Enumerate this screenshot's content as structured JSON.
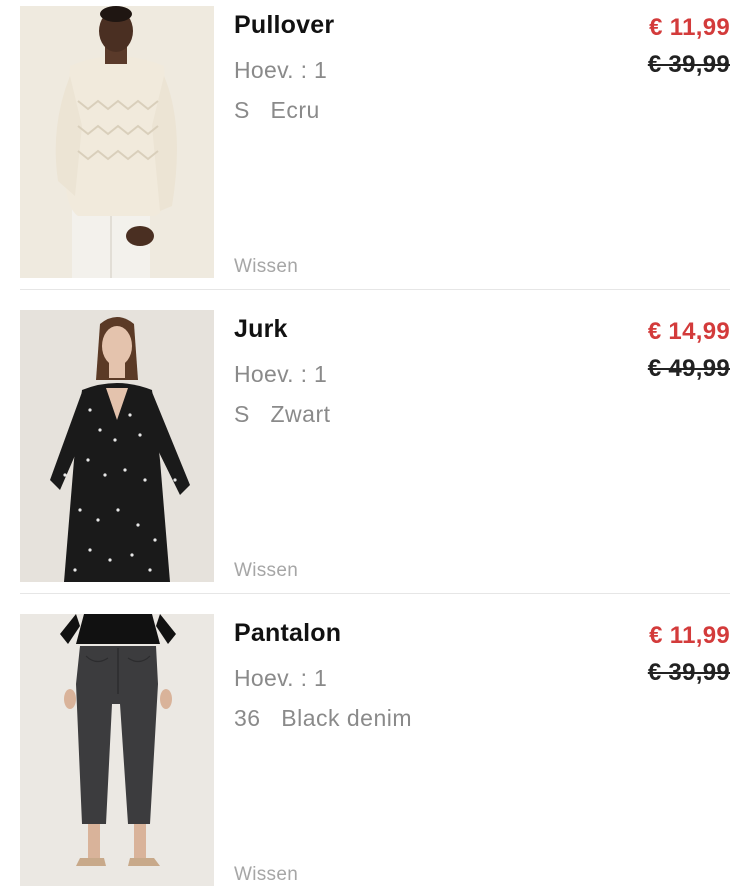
{
  "cart": {
    "items": [
      {
        "name": "Pullover",
        "quantity_text": "Hoev. : 1",
        "size": "S",
        "color": "Ecru",
        "variant_text": "S   Ecru",
        "price_now": "€ 11,99",
        "price_old": "€ 39,99",
        "remove_label": "Wissen",
        "image": "woman-cream-knit-sweater-photo"
      },
      {
        "name": "Jurk",
        "quantity_text": "Hoev. : 1",
        "size": "S",
        "color": "Zwart",
        "variant_text": "S   Zwart",
        "price_now": "€ 14,99",
        "price_old": "€ 49,99",
        "remove_label": "Wissen",
        "image": "woman-black-floral-dress-photo"
      },
      {
        "name": "Pantalon",
        "quantity_text": "Hoev. : 1",
        "size": "36",
        "color": "Black denim",
        "variant_text": "36   Black denim",
        "price_now": "€ 11,99",
        "price_old": "€ 39,99",
        "remove_label": "Wissen",
        "image": "woman-black-denim-jeans-photo"
      }
    ]
  },
  "colors": {
    "sale_price": "#d33b3b",
    "secondary_text": "#8a8a8a",
    "remove_link": "#a6a6a6",
    "divider": "#e6e6e6"
  }
}
